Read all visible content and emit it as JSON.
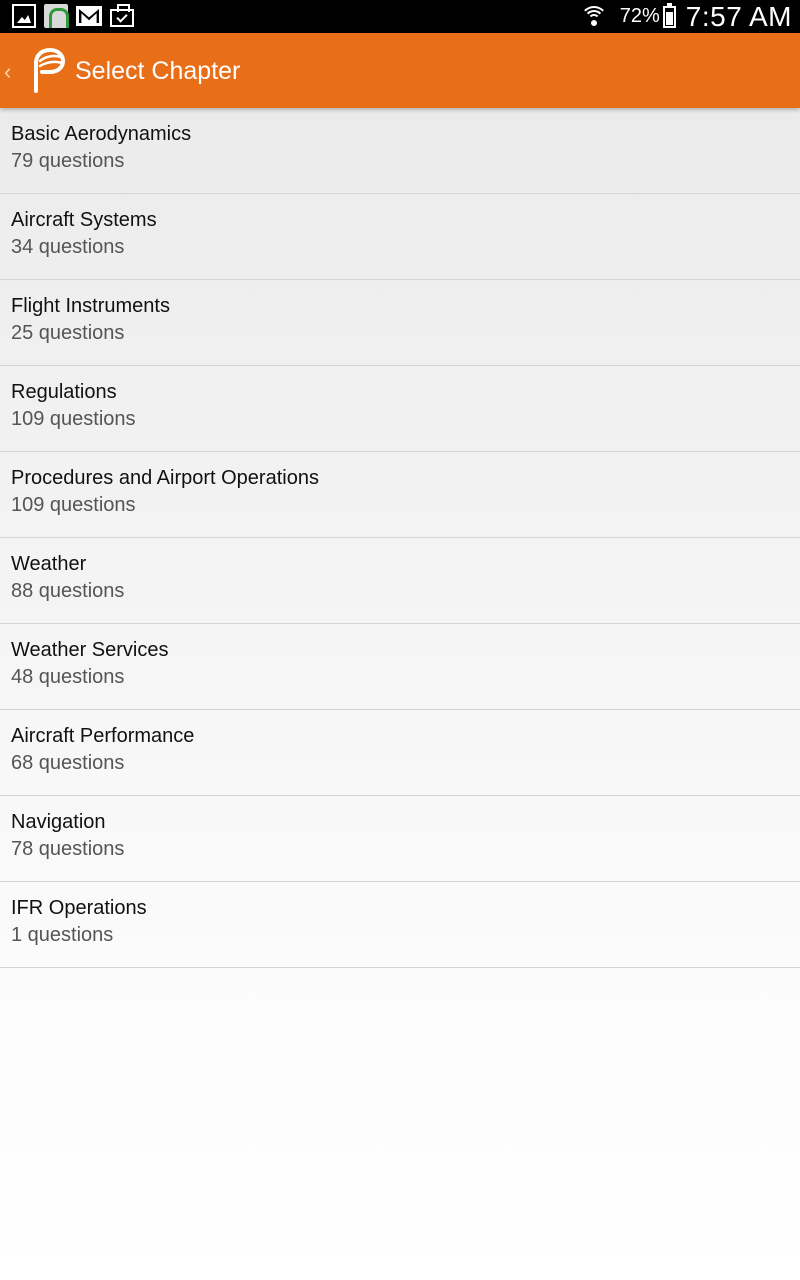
{
  "status_bar": {
    "icons": [
      "gallery-icon",
      "arch-app-icon",
      "gmail-icon",
      "bag-check-icon"
    ],
    "battery": "72%",
    "time": "7:57 AM"
  },
  "action_bar": {
    "title": "Select Chapter",
    "back_glyph": "‹",
    "color": "#e86e17"
  },
  "chapters": [
    {
      "title": "Basic Aerodynamics",
      "count": "79 questions"
    },
    {
      "title": "Aircraft Systems",
      "count": "34 questions"
    },
    {
      "title": "Flight Instruments",
      "count": "25 questions"
    },
    {
      "title": "Regulations",
      "count": "109 questions"
    },
    {
      "title": "Procedures and Airport Operations",
      "count": "109 questions"
    },
    {
      "title": "Weather",
      "count": "88 questions"
    },
    {
      "title": "Weather Services",
      "count": "48 questions"
    },
    {
      "title": "Aircraft Performance",
      "count": "68 questions"
    },
    {
      "title": "Navigation",
      "count": "78 questions"
    },
    {
      "title": "IFR Operations",
      "count": "1 questions"
    }
  ]
}
